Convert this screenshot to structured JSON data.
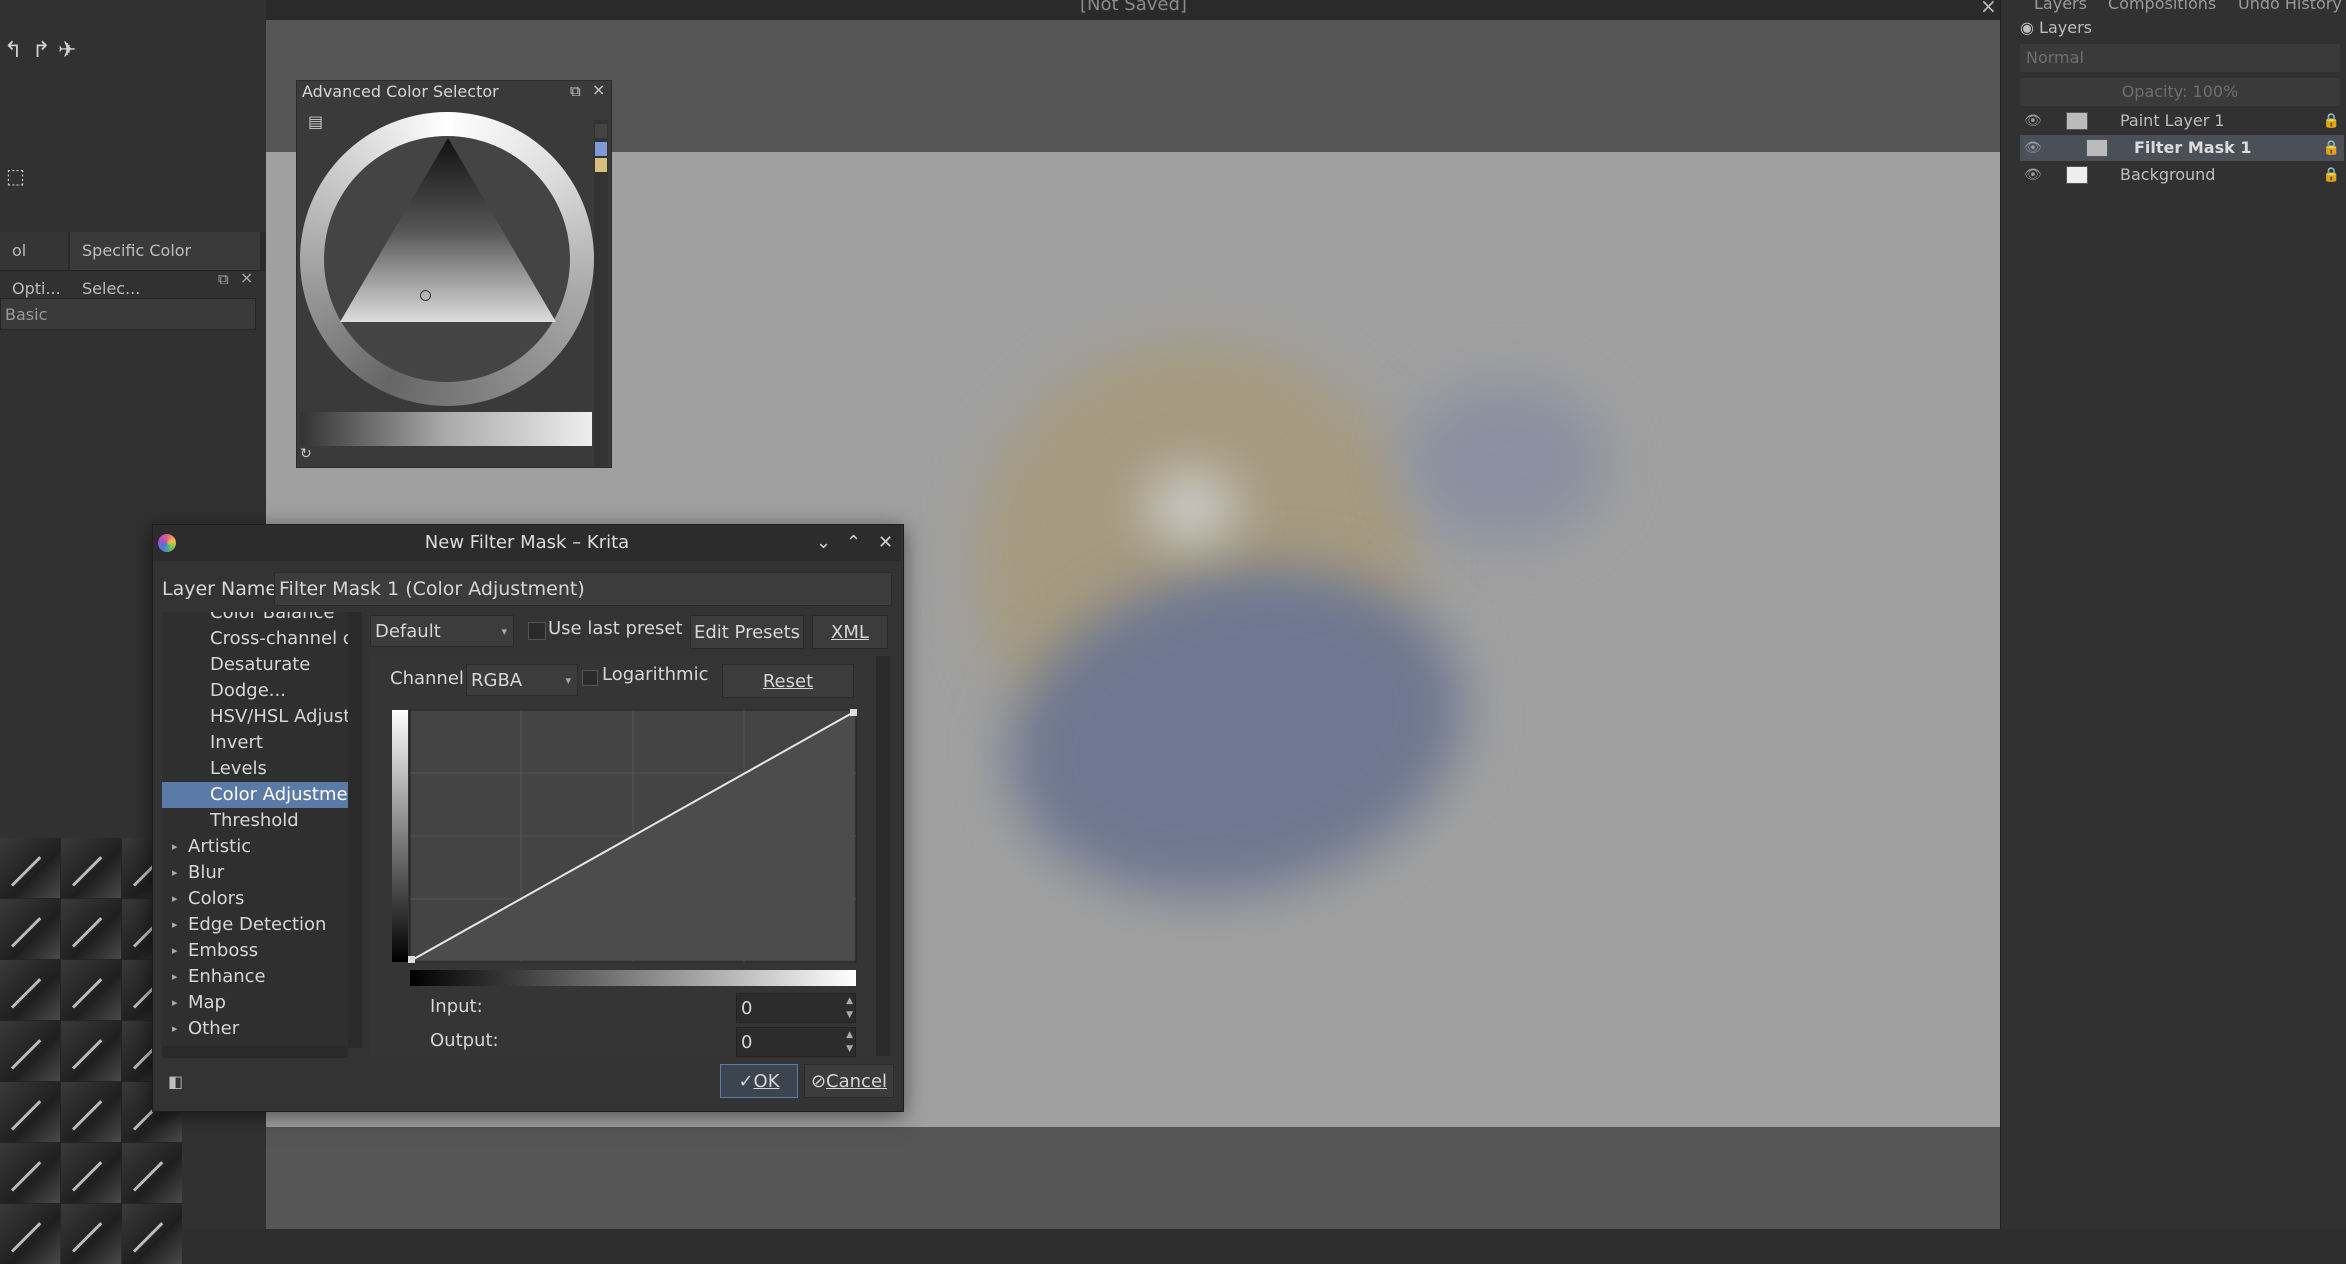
{
  "window": {
    "title": "[Not Saved]",
    "close_glyph": "×"
  },
  "left_dock": {
    "tool_glyphs": [
      "↰",
      "↱",
      "✈"
    ],
    "selection_icon": "⬚",
    "tabs": [
      "ol Opti...",
      "Specific Color Selec..."
    ],
    "preset": "Basic",
    "brush_count": 21
  },
  "right_dock": {
    "tabs": [
      "Layers",
      "Compositions",
      "Undo History"
    ],
    "panel_title": "Layers",
    "blend_mode": "Normal",
    "opacity": "Opacity:  100%",
    "layers": [
      {
        "name": "Paint Layer 1"
      },
      {
        "name": "Filter Mask 1"
      },
      {
        "name": "Background"
      }
    ]
  },
  "color_selector": {
    "title": "Advanced Color Selector",
    "swatches": [
      "#7f9ad6",
      "#d9bf7e"
    ]
  },
  "dialog": {
    "title": "New Filter Mask – Krita",
    "layer_name_label": "Layer Name:",
    "layer_name_value": "Filter Mask 1 (Color Adjustment)",
    "tree": {
      "children": [
        "Color Balance",
        "Cross-channel color adjustment",
        "Desaturate",
        "Dodge...",
        "HSV/HSL Adjustment",
        "Invert",
        "Levels",
        "Color Adjustment curves",
        "Threshold"
      ],
      "selected_index": 7,
      "categories": [
        "Artistic",
        "Blur",
        "Colors",
        "Edge Detection",
        "Emboss",
        "Enhance",
        "Map",
        "Other"
      ]
    },
    "preset": "Default",
    "use_last_preset": "Use last preset",
    "edit_presets": "Edit Presets",
    "xml": "XML",
    "channel_label": "Channel:",
    "channel_value": "RGBA",
    "logarithmic": "Logarithmic",
    "reset": "Reset",
    "input_label": "Input:",
    "input_value": "0",
    "output_label": "Output:",
    "output_value": "0",
    "ok": "OK",
    "cancel": "Cancel"
  },
  "colors": {
    "selection": "#5a7ba8",
    "canvas": "#a0a0a0",
    "dialog_bg": "#333333"
  }
}
